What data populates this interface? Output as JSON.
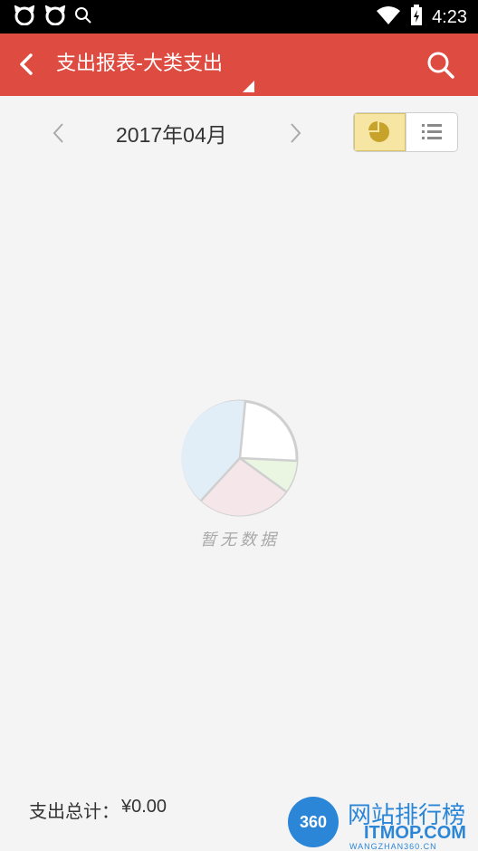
{
  "status_bar": {
    "time": "4:23",
    "icons": [
      "cat-icon",
      "cat-icon",
      "search-icon",
      "wifi-icon",
      "battery-icon"
    ]
  },
  "app_bar": {
    "title": "支出报表-大类支出",
    "back_icon": "back-arrow-icon",
    "search_icon": "search-icon",
    "bg_color": "#de4c41"
  },
  "month_nav": {
    "label": "2017年04月",
    "prev_icon": "chevron-left-icon",
    "next_icon": "chevron-right-icon"
  },
  "view_toggle": {
    "options": [
      "pie-chart-icon",
      "list-icon"
    ],
    "selected": "pie-chart-icon"
  },
  "empty_state": {
    "text": "暂无数据",
    "icon": "empty-pie-chart-icon"
  },
  "footer": {
    "label": "支出总计：",
    "amount": "¥0.00"
  },
  "watermark": {
    "badge": "360",
    "title": "网站排行榜",
    "url": "ITMOP.COM",
    "sub": "WANGZHAN360.CN"
  }
}
